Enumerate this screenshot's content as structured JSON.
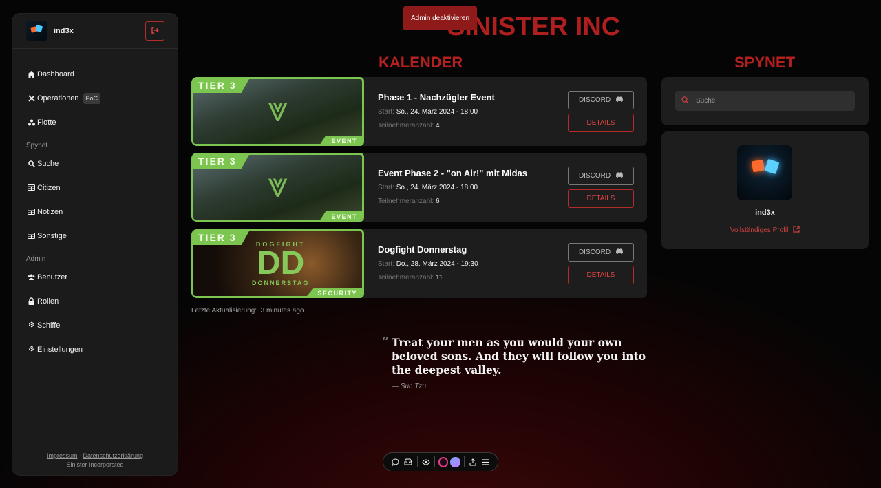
{
  "sidebar": {
    "username": "ind3x",
    "nav": [
      {
        "label": "Dashboard",
        "icon": "home-icon"
      },
      {
        "label": "Operationen",
        "icon": "crossed-swords-icon",
        "badge": "PoC"
      },
      {
        "label": "Flotte",
        "icon": "fleet-icon"
      }
    ],
    "spynet_section": "Spynet",
    "spynet_nav": [
      {
        "label": "Suche",
        "icon": "search-icon"
      },
      {
        "label": "Citizen",
        "icon": "table-icon"
      },
      {
        "label": "Notizen",
        "icon": "table-icon"
      },
      {
        "label": "Sonstige",
        "icon": "table-icon"
      }
    ],
    "admin_section": "Admin",
    "admin_nav": [
      {
        "label": "Benutzer",
        "icon": "users-icon"
      },
      {
        "label": "Rollen",
        "icon": "lock-icon"
      },
      {
        "label": "Schiffe",
        "icon": "gear-icon"
      },
      {
        "label": "Einstellungen",
        "icon": "gear-icon"
      }
    ],
    "footer": {
      "impressum": "Impressum",
      "separator": "-",
      "privacy": "Datenschutzerklärung",
      "company": "Sinister Incorporated"
    }
  },
  "header": {
    "brand": "SINISTER INC",
    "toast": "Admin deaktivieren"
  },
  "calendar": {
    "title": "KALENDER",
    "start_label": "Start:",
    "participants_label": "Teilnehmeranzahl:",
    "discord_label": "DISCORD",
    "details_label": "DETAILS",
    "events": [
      {
        "title": "Phase 1 - Nachzügler Event",
        "start": "So., 24. März 2024 - 18:00",
        "participants": "4",
        "tier": "TIER 3",
        "tag": "EVENT"
      },
      {
        "title": "Event Phase 2 - \"on Air!\" mit Midas",
        "start": "So., 24. März 2024 - 18:00",
        "participants": "6",
        "tier": "TIER 3",
        "tag": "EVENT"
      },
      {
        "title": "Dogfight Donnerstag",
        "start": "Do., 28. März 2024 - 19:30",
        "participants": "11",
        "tier": "TIER 3",
        "tag": "SECURITY",
        "banner_top": "DOGFIGHT",
        "banner_mid": "DD",
        "banner_bottom": "DONNERSTAG"
      }
    ],
    "last_update_label": "Letzte Aktualisierung:",
    "last_update_value": "3 minutes ago"
  },
  "quote": {
    "text": "Treat your men as you would your own beloved sons. And they will follow you into the deepest valley.",
    "author": "— Sun Tzu"
  },
  "spynet": {
    "title": "SPYNET",
    "search_placeholder": "Suche",
    "profile_name": "ind3x",
    "profile_link": "Vollständiges Profil"
  },
  "colors": {
    "accent": "#b01f1f",
    "tier_green": "#7cc550",
    "card_bg": "#1d1d1d"
  }
}
